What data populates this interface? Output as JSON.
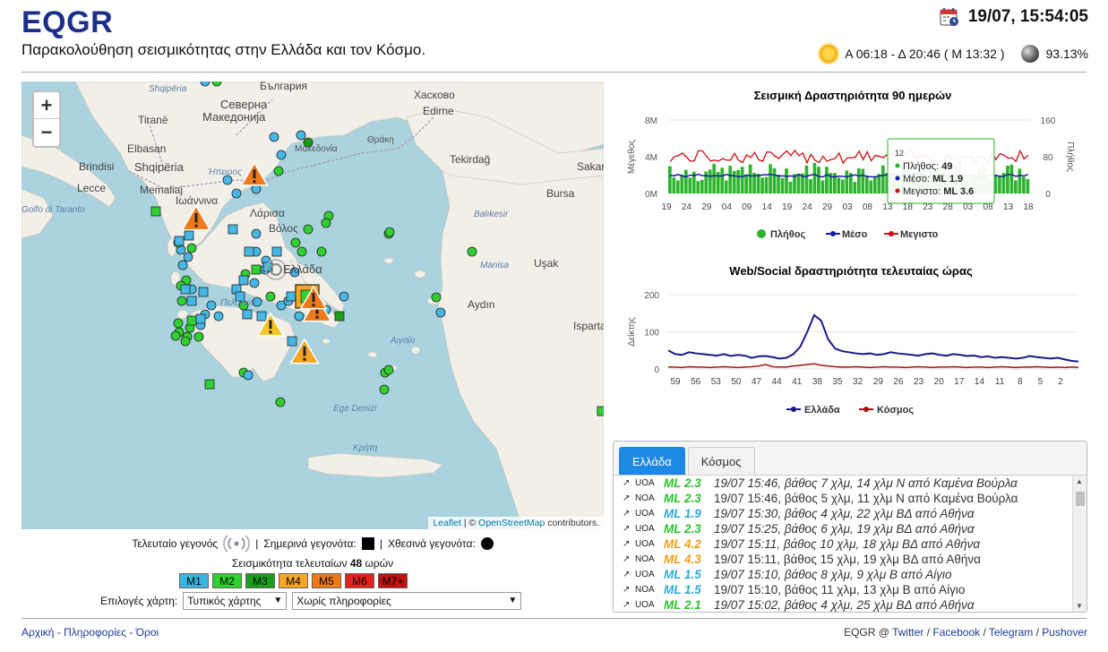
{
  "header": {
    "logo": "EQGR",
    "subtitle": "Παρακολούθηση σεισμικότητας στην Ελλάδα και τον Κόσμο.",
    "datetime": "19/07, 15:54:05",
    "sun_times": "Α 06:18 - Δ 20:46 ( Μ 13:32 )",
    "moon_percent": "93.13%"
  },
  "map": {
    "zoom_in": "+",
    "zoom_out": "−",
    "attribution_leaflet": "Leaflet",
    "attribution_sep": " | © ",
    "attribution_osm": "OpenStreetMap",
    "attribution_tail": " contributors.",
    "labels": {
      "shqiperia_top": "Shqipëria",
      "bulgaria": "България",
      "haskovo": "Хасково",
      "edirne": "Edirne",
      "tirane": "Tiranë",
      "makedonija1": "Северна",
      "makedonija2": "Македонија",
      "makedonia": "Μακεδονία",
      "thraki": "Θράκη",
      "tekirdag": "Tekirdağ",
      "sakarya": "Sakarya",
      "bursa": "Bursa",
      "balikesir": "Balıkesir",
      "brindisi": "Brindisi",
      "lecce": "Lecce",
      "taranto": "Golfo di Taranto",
      "elbasan": "Elbasan",
      "shqiperia": "Shqipëria",
      "memaliaj": "Memaliaj",
      "ioannina": "Ιωάννινα",
      "ipeiros": "Ήπειρος",
      "larisa": "Λάρισα",
      "volos": "Βόλος",
      "ellada": "Ελλάδα",
      "usak": "Uşak",
      "manisa": "Manisa",
      "aydin": "Aydın",
      "pelopon": "Πελοπόν",
      "aigaio": "Αιγαίο",
      "isparta": "Isparta",
      "kriti": "Κρήτη",
      "ege": "Ege Denizi"
    }
  },
  "legend": {
    "last_event": "Τελευταίο γεγονός",
    "today_events": "Σημερινά γεγονότα:",
    "yesterday_events": "Χθεσινά γεγονότα:",
    "seismicity_prefix": "Σεισμικότητα τελευταίων",
    "hours": "48",
    "seismicity_suffix": "ωρών",
    "magnitudes": [
      {
        "label": "M1",
        "color": "#3ab4e0"
      },
      {
        "label": "M2",
        "color": "#2ed12e"
      },
      {
        "label": "M3",
        "color": "#1a9e1a"
      },
      {
        "label": "M4",
        "color": "#f5a623"
      },
      {
        "label": "M5",
        "color": "#f07a1a"
      },
      {
        "label": "M6",
        "color": "#e52020"
      },
      {
        "label": "M7+",
        "color": "#c01010"
      }
    ],
    "map_options_label": "Επιλογές χάρτη:",
    "map_type": "Τυπικός χάρτης",
    "map_info": "Χωρίς πληροφορίες"
  },
  "chart_data": [
    {
      "type": "bar",
      "title": "Σεισμική Δραστηριότητα 90 ημερών",
      "ylabel": "Μέγεθος",
      "y2label": "Πλήθος",
      "y_ticks": [
        "8M",
        "4M",
        "0M"
      ],
      "y2_ticks": [
        "160",
        "80",
        "0"
      ],
      "x_ticks": [
        "19",
        "24",
        "29",
        "04",
        "09",
        "14",
        "19",
        "24",
        "29",
        "03",
        "08",
        "13",
        "18",
        "23",
        "28",
        "03",
        "08",
        "13",
        "18"
      ],
      "legend": [
        "Πλήθος",
        "Μέσο",
        "Μεγιστο"
      ],
      "colors": {
        "count": "#2cb52c",
        "mean": "#1a1aa8",
        "max": "#cc1111"
      },
      "tooltip": {
        "day": "12",
        "count_label": "Πλήθος:",
        "count_value": "49",
        "mean_label": "Μέσο:",
        "mean_value": "ML 1.9",
        "max_label": "Μεγιστο:",
        "max_value": "ML 3.6"
      }
    },
    {
      "type": "line",
      "title": "Web/Social δραστηριότητα τελευταίας ώρας",
      "ylabel": "Δείκτης",
      "y_ticks": [
        "200",
        "100",
        "0"
      ],
      "x_ticks": [
        "59",
        "56",
        "53",
        "50",
        "47",
        "44",
        "41",
        "38",
        "35",
        "32",
        "29",
        "26",
        "23",
        "20",
        "17",
        "14",
        "11",
        "8",
        "5",
        "2"
      ],
      "legend": [
        "Ελλάδα",
        "Κόσμος"
      ],
      "colors": {
        "greece": "#1a1a8c",
        "world": "#aa1111"
      }
    }
  ],
  "tabs": [
    "Ελλάδα",
    "Κόσμος"
  ],
  "earthquakes": [
    {
      "src": "UOA",
      "ml": "ML 2.3",
      "color": "#2ec42e",
      "italic": true,
      "text": "19/07 15:46, βάθος 7 χλμ, 14 χλμ Ν από Καμένα Βούρλα"
    },
    {
      "src": "NOA",
      "ml": "ML 2.3",
      "color": "#2ec42e",
      "italic": false,
      "text": "19/07 15:46, βάθος 5 χλμ, 11 χλμ Ν από Καμένα Βούρλα"
    },
    {
      "src": "UOA",
      "ml": "ML 1.9",
      "color": "#33aadd",
      "italic": true,
      "text": "19/07 15:30, βάθος 4 χλμ, 22 χλμ ΒΔ από Αθήνα"
    },
    {
      "src": "UOA",
      "ml": "ML 2.3",
      "color": "#2ec42e",
      "italic": true,
      "text": "19/07 15:25, βάθος 6 χλμ, 19 χλμ ΒΔ από Αθήνα"
    },
    {
      "src": "UOA",
      "ml": "ML 4.2",
      "color": "#f0a020",
      "italic": true,
      "text": "19/07 15:11, βάθος 10 χλμ, 18 χλμ ΒΔ από Αθήνα"
    },
    {
      "src": "NOA",
      "ml": "ML 4.3",
      "color": "#f0a020",
      "italic": false,
      "text": "19/07 15:11, βάθος 15 χλμ, 19 χλμ ΒΔ από Αθήνα"
    },
    {
      "src": "UOA",
      "ml": "ML 1.5",
      "color": "#33aadd",
      "italic": true,
      "text": "19/07 15:10, βάθος 8 χλμ, 9 χλμ Β από Αίγιο"
    },
    {
      "src": "NOA",
      "ml": "ML 1.5",
      "color": "#33aadd",
      "italic": false,
      "text": "19/07 15:10, βάθος 11 χλμ, 13 χλμ Β από Αίγιο"
    },
    {
      "src": "UOA",
      "ml": "ML 2.1",
      "color": "#2ec42e",
      "italic": true,
      "text": "19/07 15:02, βάθος 4 χλμ, 25 χλμ ΒΔ από Αθήνα"
    }
  ],
  "footer": {
    "home": "Αρχική",
    "info": "Πληροφορίες",
    "terms": "Όροι",
    "sep": " - ",
    "eqgr_at": "EQGR @ ",
    "twitter": "Twitter",
    "facebook": "Facebook",
    "telegram": "Telegram",
    "pushover": "Pushover",
    "slash": " / "
  }
}
